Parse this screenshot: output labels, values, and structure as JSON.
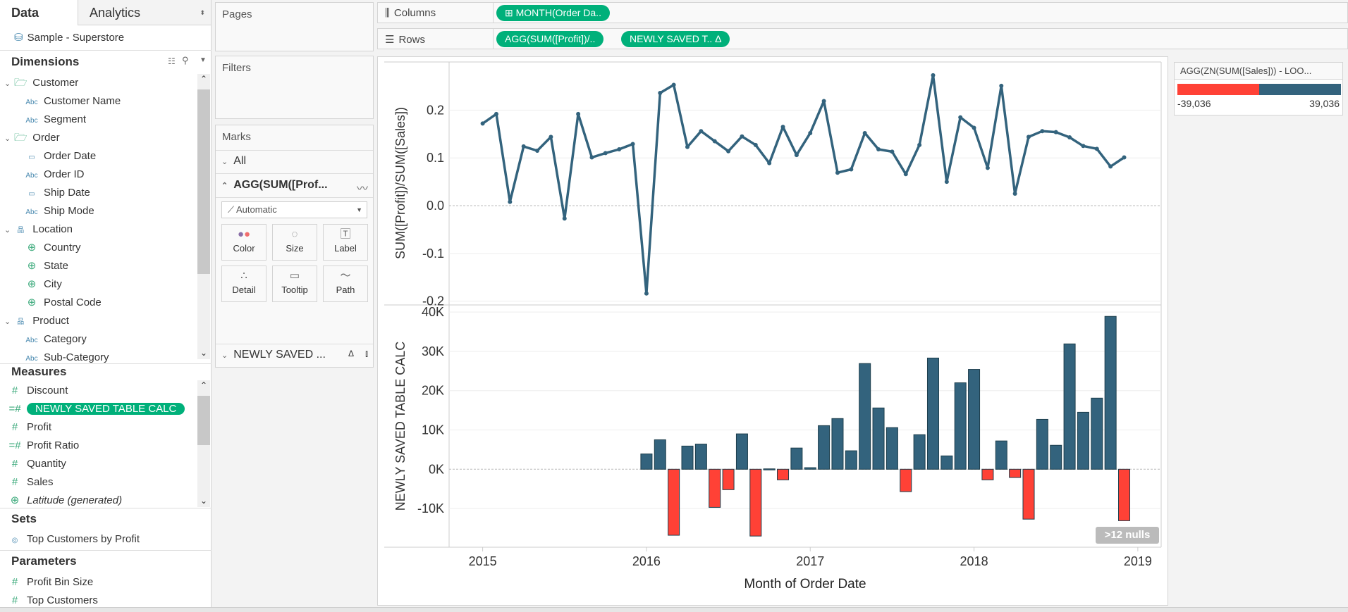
{
  "data_pane": {
    "tabs": [
      "Data",
      "Analytics"
    ],
    "datasource": "Sample - Superstore",
    "dimensions_title": "Dimensions",
    "dimensions": [
      {
        "label": "Customer",
        "icon": "folder-icon",
        "level": 0
      },
      {
        "label": "Customer Name",
        "icon": "abc-icon",
        "level": 1
      },
      {
        "label": "Segment",
        "icon": "abc-icon",
        "level": 1
      },
      {
        "label": "Order",
        "icon": "folder-icon",
        "level": 0
      },
      {
        "label": "Order Date",
        "icon": "calendar-icon",
        "level": 1
      },
      {
        "label": "Order ID",
        "icon": "abc-icon",
        "level": 1
      },
      {
        "label": "Ship Date",
        "icon": "calendar-icon",
        "level": 1
      },
      {
        "label": "Ship Mode",
        "icon": "abc-icon",
        "level": 1
      },
      {
        "label": "Location",
        "icon": "hierarchy-icon",
        "level": 0
      },
      {
        "label": "Country",
        "icon": "globe-icon",
        "level": 1
      },
      {
        "label": "State",
        "icon": "globe-icon",
        "level": 1
      },
      {
        "label": "City",
        "icon": "globe-icon",
        "level": 1
      },
      {
        "label": "Postal Code",
        "icon": "globe-icon",
        "level": 1
      },
      {
        "label": "Product",
        "icon": "hierarchy-icon",
        "level": 0
      },
      {
        "label": "Category",
        "icon": "abc-icon",
        "level": 1
      },
      {
        "label": "Sub-Category",
        "icon": "abc-icon",
        "level": 1
      }
    ],
    "measures_title": "Measures",
    "measures": [
      {
        "label": "Discount",
        "icon": "number-icon"
      },
      {
        "label": "NEWLY SAVED TABLE CALC",
        "icon": "calc-number-icon",
        "selected": true
      },
      {
        "label": "Profit",
        "icon": "number-icon"
      },
      {
        "label": "Profit Ratio",
        "icon": "calc-number-icon"
      },
      {
        "label": "Quantity",
        "icon": "number-icon"
      },
      {
        "label": "Sales",
        "icon": "number-icon"
      },
      {
        "label": "Latitude (generated)",
        "icon": "globe-icon",
        "italic": true
      }
    ],
    "sets_title": "Sets",
    "sets": [
      {
        "label": "Top Customers by Profit",
        "icon": "set-icon"
      }
    ],
    "parameters_title": "Parameters",
    "parameters": [
      {
        "label": "Profit Bin Size",
        "icon": "number-icon"
      },
      {
        "label": "Top Customers",
        "icon": "number-icon"
      }
    ]
  },
  "cards": {
    "pages": "Pages",
    "filters": "Filters",
    "marks": "Marks",
    "marks_all": "All",
    "marks_layer1": "AGG(SUM([Prof...",
    "mark_type": "Automatic",
    "mark_buttons": [
      "Color",
      "Size",
      "Label",
      "Detail",
      "Tooltip",
      "Path"
    ],
    "marks_layer2": "NEWLY SAVED ..."
  },
  "shelves": {
    "columns_label": "Columns",
    "rows_label": "Rows",
    "columns": [
      "MONTH(Order Da.."
    ],
    "rows": [
      "AGG(SUM([Profit])/..",
      "NEWLY SAVED T..  Δ"
    ]
  },
  "legend": {
    "title": "AGG(ZN(SUM([Sales])) - LOO...",
    "min": "-39,036",
    "max": "39,036",
    "colors": [
      "#ff4136",
      "#33637d"
    ]
  },
  "colors": {
    "accent": "#00b07a",
    "positive": "#33637d",
    "negative": "#ff4136",
    "line": "#33637d"
  },
  "nulls_badge": ">12 nulls",
  "chart_data": [
    {
      "type": "line",
      "ylabel": "SUM([Profit])/SUM([Sales])",
      "ylim": [
        -0.2,
        0.3
      ],
      "yticks": [
        "0.2",
        "0.1",
        "0.0",
        "-0.1",
        "-0.2"
      ],
      "ytick_values": [
        0.2,
        0.1,
        0,
        -0.1,
        -0.2
      ],
      "x_start": "2015-01",
      "x_unit": "month",
      "values": [
        0.172,
        0.192,
        0.008,
        0.124,
        0.115,
        0.144,
        -0.027,
        0.192,
        0.101,
        0.11,
        0.118,
        0.129,
        -0.184,
        0.236,
        0.253,
        0.123,
        0.156,
        0.135,
        0.114,
        0.145,
        0.127,
        0.089,
        0.165,
        0.106,
        0.152,
        0.219,
        0.069,
        0.076,
        0.152,
        0.118,
        0.113,
        0.066,
        0.127,
        0.273,
        0.05,
        0.185,
        0.163,
        0.079,
        0.251,
        0.025,
        0.144,
        0.156,
        0.154,
        0.143,
        0.125,
        0.119,
        0.082,
        0.101
      ]
    },
    {
      "type": "bar",
      "ylabel": "NEWLY SAVED TABLE CALC",
      "xlabel": "Month of Order Date",
      "ylim": [
        -20000,
        42000
      ],
      "yticks": [
        "40K",
        "30K",
        "20K",
        "10K",
        "0K",
        "-10K"
      ],
      "ytick_values": [
        40000,
        30000,
        20000,
        10000,
        0,
        -10000
      ],
      "xticks": [
        "2015",
        "2016",
        "2017",
        "2018",
        "2019"
      ],
      "x_start": "2016-01",
      "x_unit": "month",
      "values": [
        3900,
        7500,
        -16800,
        5900,
        6400,
        -9700,
        -5200,
        9000,
        -17000,
        100,
        -2700,
        5400,
        400,
        11100,
        12900,
        4700,
        26900,
        15600,
        10600,
        -5700,
        8800,
        28300,
        3400,
        22000,
        25400,
        -2700,
        7200,
        -2100,
        -12700,
        12700,
        6100,
        31900,
        14500,
        18100,
        38900,
        -13100
      ]
    }
  ]
}
